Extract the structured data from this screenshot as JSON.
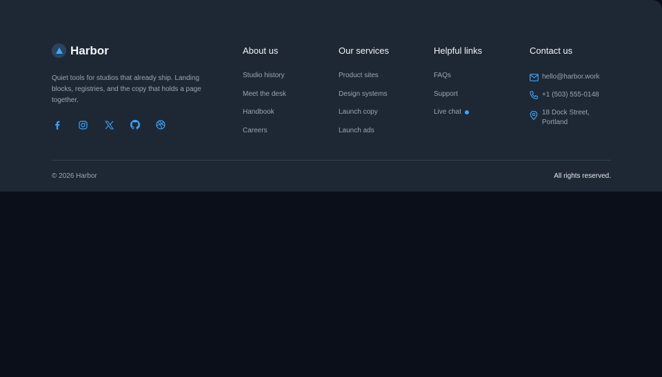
{
  "brand": {
    "name": "Harbor",
    "tagline": "Quiet tools for studios that already ship. Landing blocks, registries, and the copy that holds a page together."
  },
  "socials": [
    {
      "icon": "facebook-icon"
    },
    {
      "icon": "instagram-icon"
    },
    {
      "icon": "x-icon"
    },
    {
      "icon": "github-icon"
    },
    {
      "icon": "dribbble-icon"
    }
  ],
  "columns": {
    "about": {
      "title": "About us",
      "links": [
        "Studio history",
        "Meet the desk",
        "Handbook",
        "Careers"
      ]
    },
    "services": {
      "title": "Our services",
      "links": [
        "Product sites",
        "Design systems",
        "Launch copy",
        "Launch ads"
      ]
    },
    "helpful": {
      "title": "Helpful links",
      "links": [
        "FAQs",
        "Support",
        "Live chat"
      ]
    },
    "contact": {
      "title": "Contact us",
      "email": "hello@harbor.work",
      "phone": "+1 (503) 555-0148",
      "address": "18 Dock Street, Portland"
    }
  },
  "bottom": {
    "copyright": "© 2026 Harbor",
    "rights": "All rights reserved."
  },
  "colors": {
    "accent": "#3ea6ff",
    "footer_bg": "#1e2834",
    "page_bg": "#0a0f1a"
  }
}
